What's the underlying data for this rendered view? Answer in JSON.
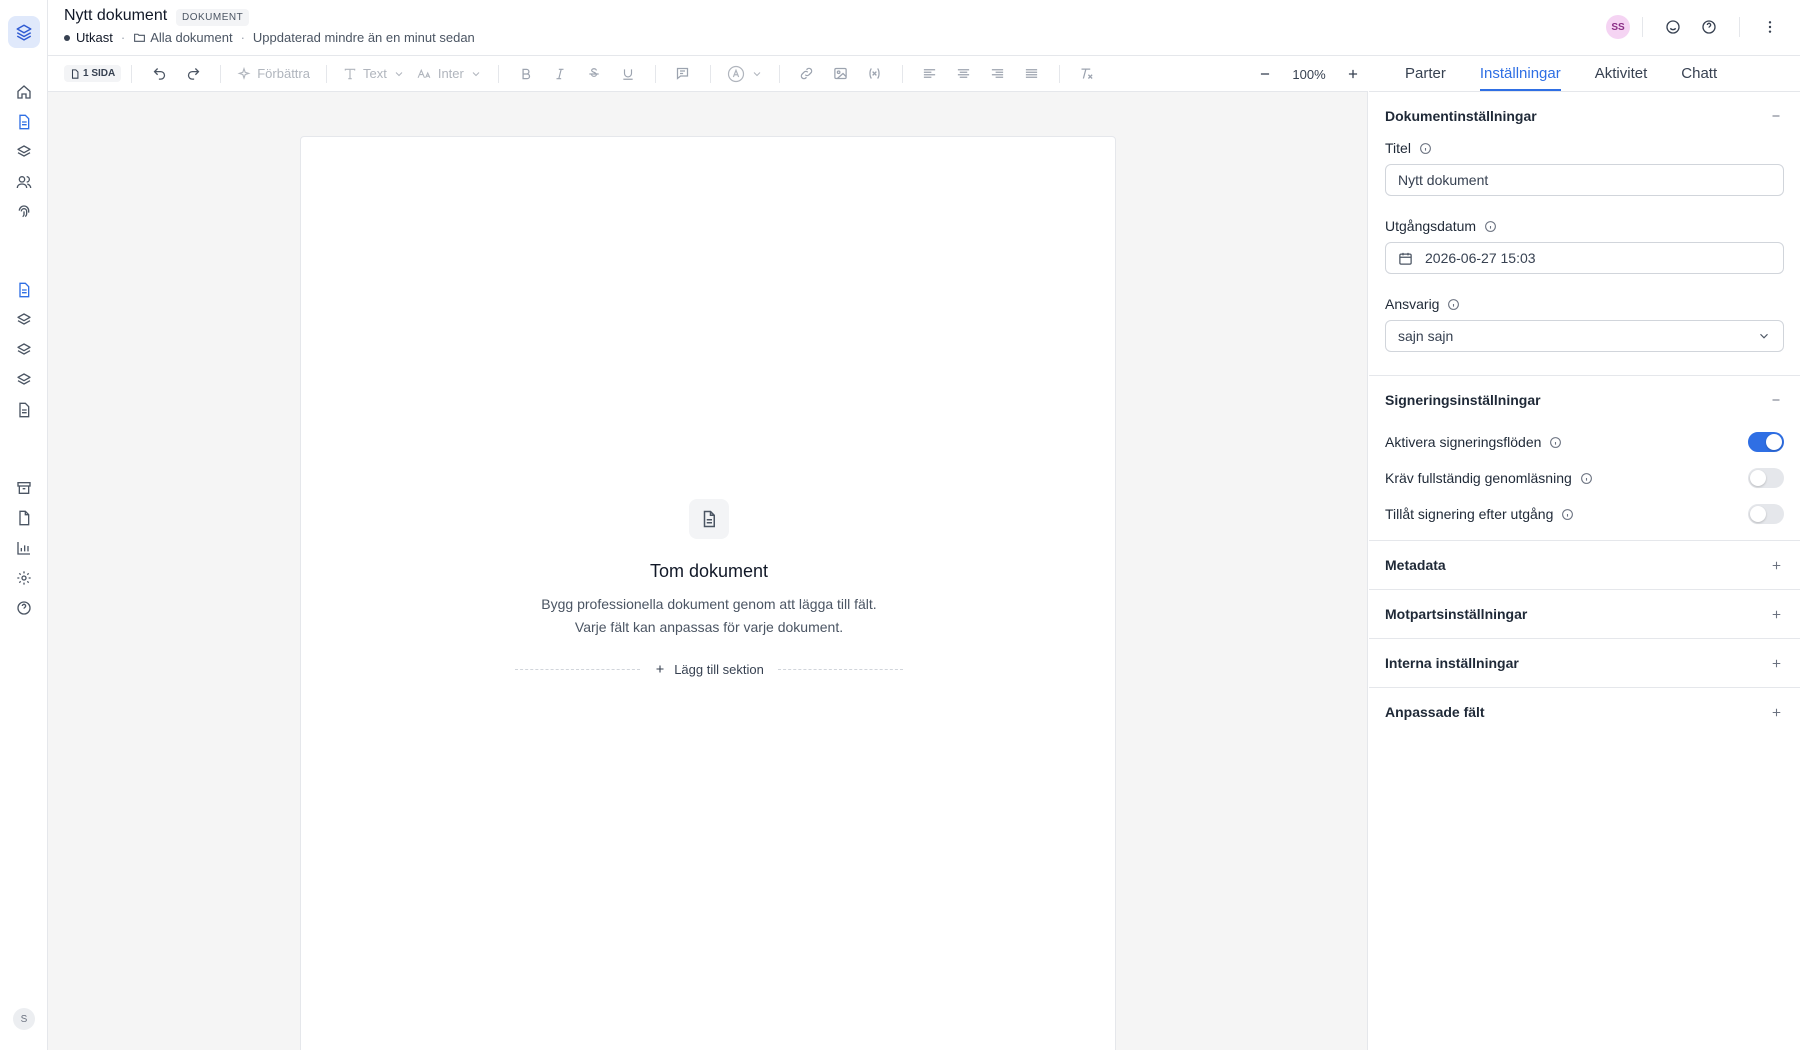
{
  "header": {
    "title": "Nytt dokument",
    "badge": "DOKUMENT",
    "status": "Utkast",
    "folder_link": "Alla dokument",
    "updated": "Uppdaterad mindre än en minut sedan",
    "avatar_initials": "SS"
  },
  "rail": {
    "user_initial": "S",
    "icons": [
      "home-icon",
      "document-icon",
      "layers-icon",
      "users-icon",
      "fingerprint-icon",
      "document-icon",
      "layers-icon",
      "layers-icon",
      "layers-icon",
      "document-icon",
      "archive-icon",
      "file-icon",
      "chart-icon",
      "gear-icon",
      "help-icon"
    ]
  },
  "toolbar": {
    "pages": "1 SIDA",
    "improve": "Förbättra",
    "text_style": "Text",
    "font": "Inter",
    "zoom": "100%"
  },
  "canvas": {
    "empty_title": "Tom dokument",
    "empty_desc": "Bygg professionella dokument genom att lägga till fält. Varje fält kan anpassas för varje dokument.",
    "add_section": "Lägg till sektion"
  },
  "panel": {
    "tabs": [
      {
        "label": "Parter",
        "active": false
      },
      {
        "label": "Inställningar",
        "active": true
      },
      {
        "label": "Aktivitet",
        "active": false
      },
      {
        "label": "Chatt",
        "active": false
      }
    ],
    "doc_settings": {
      "title": "Dokumentinställningar",
      "title_label": "Titel",
      "title_value": "Nytt dokument",
      "expiry_label": "Utgångsdatum",
      "expiry_value": "2026-06-27 15:03",
      "owner_label": "Ansvarig",
      "owner_value": "sajn sajn"
    },
    "signing": {
      "title": "Signeringsinställningar",
      "toggles": [
        {
          "label": "Aktivera signeringsflöden",
          "on": true
        },
        {
          "label": "Kräv fullständig genomläsning",
          "on": false
        },
        {
          "label": "Tillåt signering efter utgång",
          "on": false
        }
      ]
    },
    "collapsed_sections": [
      "Metadata",
      "Motpartsinställningar",
      "Interna inställningar",
      "Anpassade fält"
    ]
  },
  "colors": {
    "accent": "#2f6fe4",
    "badge_avatar_bg": "#f5d4f3",
    "canvas_bg": "#f5f5f5"
  }
}
